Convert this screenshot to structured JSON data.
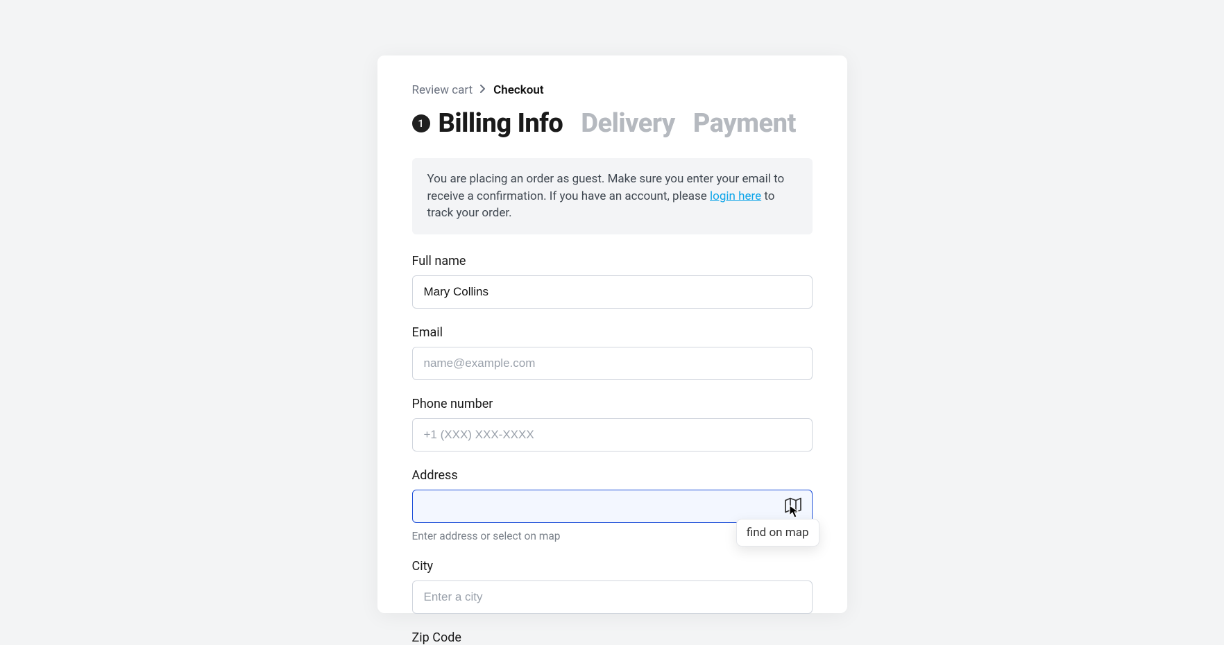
{
  "breadcrumb": {
    "prev": "Review cart",
    "current": "Checkout"
  },
  "steps": {
    "active_number": "1",
    "active_label": "Billing Info",
    "inactive1": "Delivery",
    "inactive2": "Payment"
  },
  "notice": {
    "text_before": "You are placing an order as guest. Make sure you enter your email to receive a confirmation. If you have an account, please ",
    "login_text": "login here",
    "text_after": " to track your order."
  },
  "fields": {
    "full_name": {
      "label": "Full name",
      "value": "Mary Collins"
    },
    "email": {
      "label": "Email",
      "placeholder": "name@example.com",
      "value": ""
    },
    "phone": {
      "label": "Phone number",
      "placeholder": "+1 (XXX) XXX-XXXX",
      "value": ""
    },
    "address": {
      "label": "Address",
      "value": "",
      "helper": "Enter address or select on map",
      "tooltip": "find on map"
    },
    "city": {
      "label": "City",
      "placeholder": "Enter a city",
      "value": ""
    },
    "zip": {
      "label": "Zip Code"
    }
  }
}
